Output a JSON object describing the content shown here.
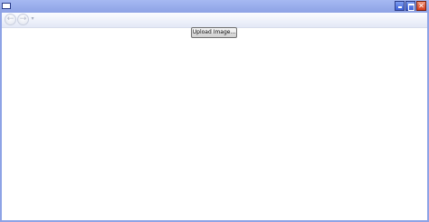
{
  "window": {
    "title": "",
    "controls": {
      "minimize_icon": "minimize-icon",
      "maximize_icon": "maximize-icon",
      "close_icon": "close-icon",
      "close_glyph": "✕"
    }
  },
  "navigation": {
    "back_icon": "back-arrow-icon",
    "back_glyph": "←",
    "forward_icon": "forward-arrow-icon",
    "forward_glyph": "→",
    "history_icon": "history-dropdown-icon",
    "history_glyph": "▾"
  },
  "content": {
    "upload_button_label": "Upload Image..."
  },
  "colors": {
    "frame": "#8ea3e6",
    "titlebar": "#a6b9f2",
    "close_button": "#d43c1d",
    "background": "#ffffff"
  }
}
